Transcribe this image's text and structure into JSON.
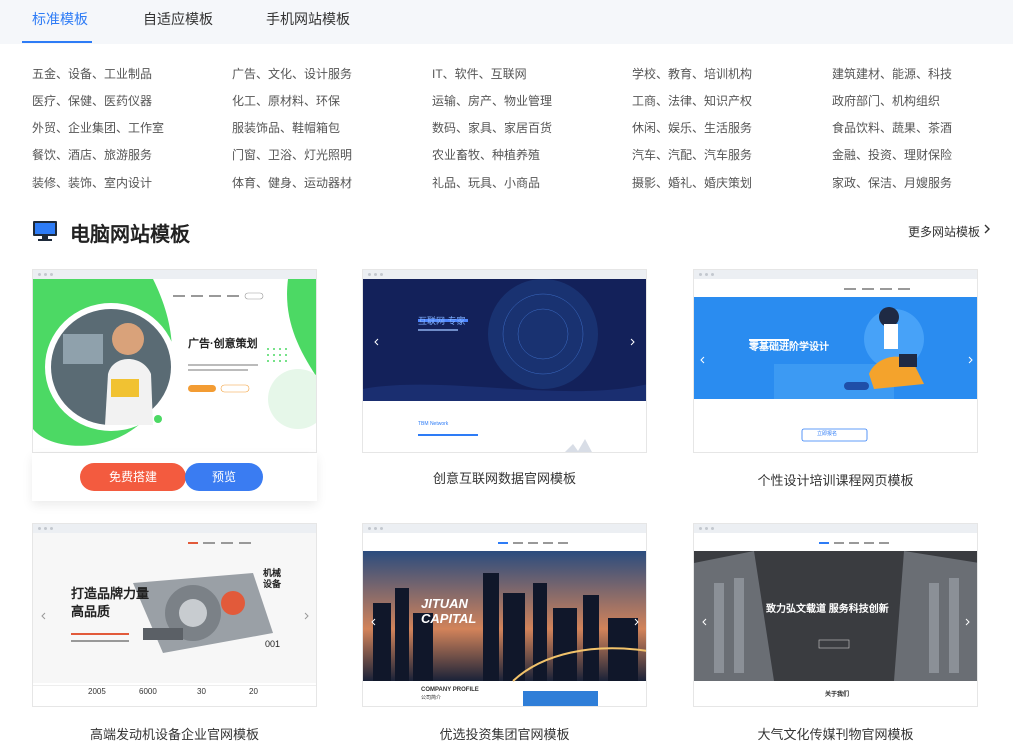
{
  "tabs": [
    {
      "label": "标准模板",
      "active": true
    },
    {
      "label": "自适应模板",
      "active": false
    },
    {
      "label": "手机网站模板",
      "active": false
    }
  ],
  "categories": [
    [
      "五金、设备、工业制品",
      "医疗、保健、医药仪器",
      "外贸、企业集团、工作室",
      "餐饮、酒店、旅游服务",
      "装修、装饰、室内设计"
    ],
    [
      "广告、文化、设计服务",
      "化工、原材料、环保",
      "服装饰品、鞋帽箱包",
      "门窗、卫浴、灯光照明",
      "体育、健身、运动器材"
    ],
    [
      "IT、软件、互联网",
      "运输、房产、物业管理",
      "数码、家具、家居百货",
      "农业畜牧、种植养殖",
      "礼品、玩具、小商品"
    ],
    [
      "学校、教育、培训机构",
      "工商、法律、知识产权",
      "休闲、娱乐、生活服务",
      "汽车、汽配、汽车服务",
      "摄影、婚礼、婚庆策划"
    ],
    [
      "建筑建材、能源、科技",
      "政府部门、机构组织",
      "食品饮料、蔬果、茶酒",
      "金融、投资、理财保险",
      "家政、保洁、月嫂服务"
    ]
  ],
  "section": {
    "title": "电脑网站模板",
    "more": "更多网站模板"
  },
  "cards": [
    {
      "caption": "",
      "build": "免费搭建",
      "preview": "预览",
      "hero": "广告·创意策划"
    },
    {
      "caption": "创意互联网数据官网模板",
      "hero": "互联网 专家",
      "sub": "TBM Network"
    },
    {
      "caption": "个性设计培训课程网页模板",
      "hero": "零基础进阶学设计",
      "btn": "立即报名"
    },
    {
      "caption": "高端发动机设备企业官网模板",
      "hero": "打造品牌力量",
      "hero2": "高品质",
      "tag": "机械设备",
      "num": "001",
      "stats": [
        "2005",
        "6000",
        "30",
        "20"
      ]
    },
    {
      "caption": "优选投资集团官网模板",
      "hero": "JITUAN",
      "hero2": "CAPITAL",
      "profile": "COMPANY PROFILE",
      "profile2": "公司简介"
    },
    {
      "caption": "大气文化传媒刊物官网模板",
      "hero": "致力弘文载道 服务科技创新",
      "about": "关于我们"
    }
  ],
  "colors": {
    "accent": "#2e7cf6",
    "build": "#f35b3f",
    "preview": "#3a7cf2",
    "green": "#4cd964"
  }
}
